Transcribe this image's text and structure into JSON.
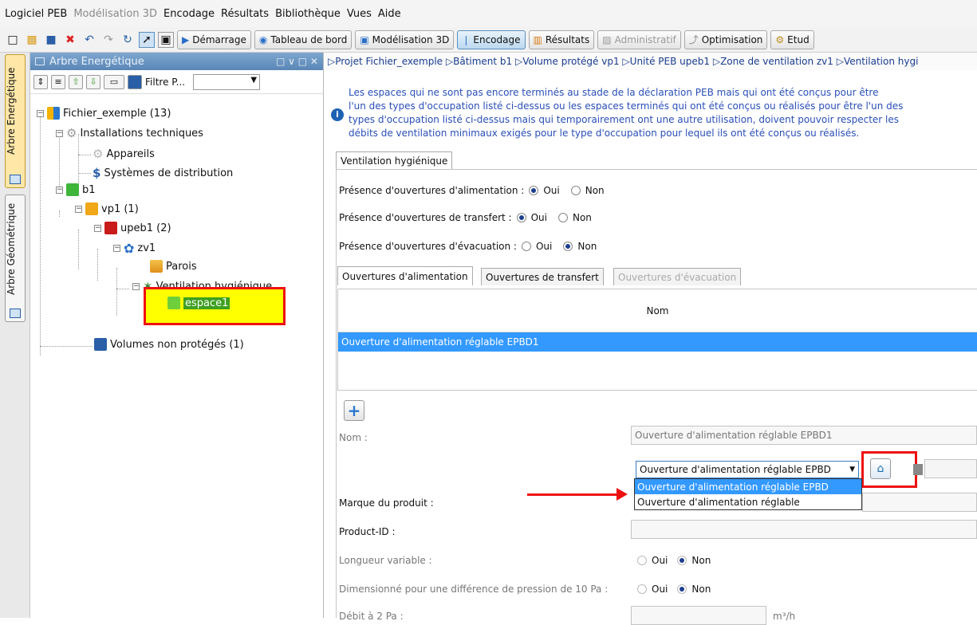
{
  "menubar": {
    "items": [
      "Logiciel PEB",
      "Modélisation 3D",
      "Encodage",
      "Résultats",
      "Bibliothèque",
      "Vues",
      "Aide"
    ]
  },
  "toolbar": {
    "buttons": [
      "Démarrage",
      "Tableau de bord",
      "Modélisation 3D",
      "Encodage",
      "Résultats",
      "Administratif",
      "Optimisation",
      "Etud"
    ]
  },
  "left_tabs": {
    "energy": "Arbre Energétique",
    "geometry": "Arbre Géométrique"
  },
  "tree_panel": {
    "title": "Arbre Energétique",
    "filter_label": "Filtre P...",
    "nodes": [
      "Fichier_exemple (13)",
      "Installations techniques",
      "Appareils",
      "Systèmes de distribution",
      "b1",
      "vp1 (1)",
      "upeb1 (2)",
      "zv1",
      "Parois",
      "Ventilation hygiénique",
      "espace1",
      "Volumes non protégés (1)"
    ]
  },
  "breadcrumb": [
    "Projet Fichier_exemple",
    "Bâtiment b1",
    "Volume protégé vp1",
    "Unité PEB upeb1",
    "Zone de ventilation zv1",
    "Ventilation hygi"
  ],
  "info_text": [
    "Les espaces qui ne sont pas encore terminés au stade de la déclaration PEB mais qui ont été conçus pour être",
    "l'un des types d'occupation listé ci-dessus ou les espaces terminés qui ont été conçus ou réalisés pour être l'un des",
    "types d'occupation listé ci-dessus mais qui temporairement ont une autre utilisation, doivent pouvoir respecter les",
    "débits de ventilation minimaux exigés pour le type d'occupation pour lequel ils ont été conçus ou réalisés."
  ],
  "main_tab": "Ventilation hygiénique",
  "presence": {
    "alimentation": {
      "label": "Présence d'ouvertures d'alimentation :",
      "oui": "Oui",
      "non": "Non"
    },
    "transfert": {
      "label": "Présence d'ouvertures de transfert :",
      "oui": "Oui",
      "non": "Non"
    },
    "evacuation": {
      "label": "Présence d'ouvertures d'évacuation :",
      "oui": "Oui",
      "non": "Non"
    }
  },
  "sub_tabs": [
    "Ouvertures d'alimentation",
    "Ouvertures de transfert",
    "Ouvertures d'évacuation"
  ],
  "table": {
    "header": "Nom",
    "row": "Ouverture d'alimentation réglable EPBD1"
  },
  "form": {
    "nom_label": "Nom :",
    "nom_value": "Ouverture d'alimentation réglable EPBD1",
    "select_value": "Ouverture d'alimentation réglable EPBD",
    "options": [
      "Ouverture d'alimentation réglable EPBD",
      "Ouverture d'alimentation réglable"
    ],
    "marque_label": "Marque du produit :",
    "product_id_label": "Product-ID :",
    "longueur_label": "Longueur variable :",
    "longueur_oui": "Oui",
    "longueur_non": "Non",
    "dimension_label": "Dimensionné pour une différence de pression de 10 Pa :",
    "dimension_oui": "Oui",
    "dimension_non": "Non",
    "debit_label": "Débit à 2 Pa :",
    "debit_unit": "m³/h"
  },
  "colors": {
    "highlight": "#ffff00",
    "annotation": "#e11111",
    "selection": "#3399ff",
    "link": "#1a3d8f"
  }
}
